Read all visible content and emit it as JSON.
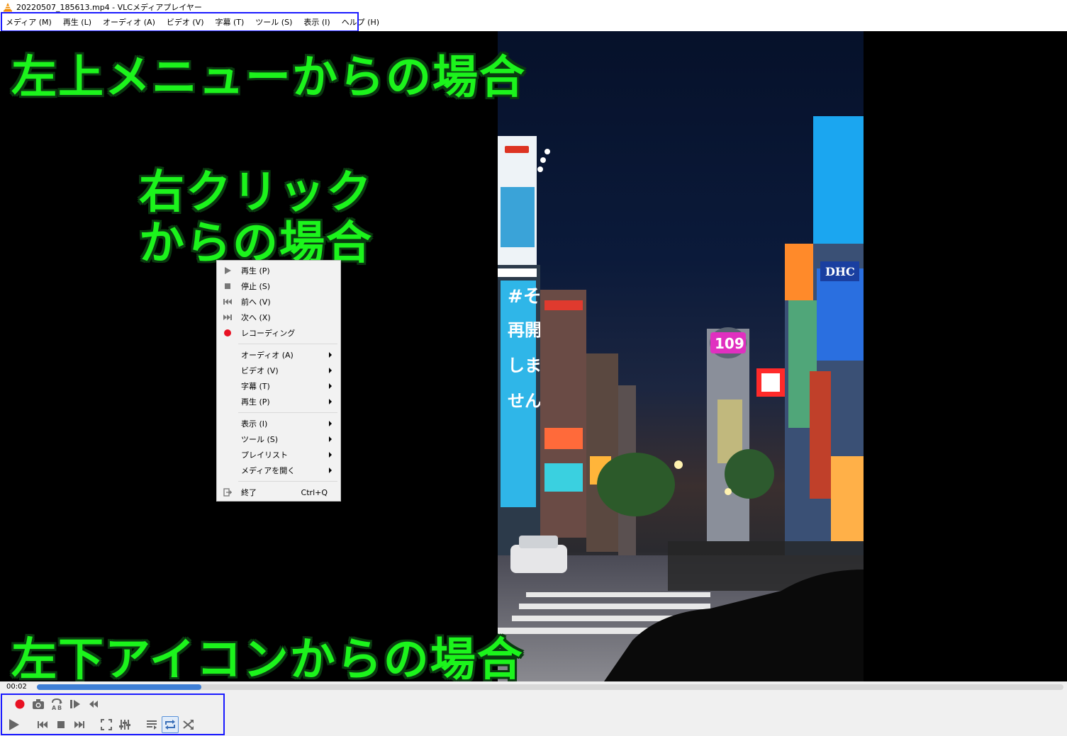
{
  "window": {
    "title": "20220507_185613.mp4 - VLCメディアプレイヤー"
  },
  "menubar": [
    "メディア (M)",
    "再生 (L)",
    "オーディオ (A)",
    "ビデオ (V)",
    "字幕 (T)",
    "ツール (S)",
    "表示 (I)",
    "ヘルプ (H)"
  ],
  "annotations": {
    "top": "左上メニューからの場合",
    "middle_line1": "右クリック",
    "middle_line2": "からの場合",
    "bottom": "左下アイコンからの場合"
  },
  "context_menu": {
    "play": "再生 (P)",
    "stop": "停止 (S)",
    "prev": "前へ (V)",
    "next": "次へ (X)",
    "record": "レコーディング",
    "audio": "オーディオ (A)",
    "video": "ビデオ (V)",
    "subtitle": "字幕 (T)",
    "playback": "再生 (P)",
    "view": "表示 (I)",
    "tools": "ツール (S)",
    "playlist": "プレイリスト",
    "open_media": "メディアを開く",
    "quit": "終了",
    "quit_shortcut": "Ctrl+Q"
  },
  "playback": {
    "time": "00:02",
    "progress": 0.16
  },
  "photo_signs": {
    "tower": "109",
    "dhc": "DHC",
    "vertical": "#そろそろデート再開しませんか"
  },
  "colors": {
    "annotation_green": "#1cf41c",
    "highlight_blue": "#1a1aff",
    "seek_blue": "#3e7fd6",
    "record_red": "#e81123"
  }
}
